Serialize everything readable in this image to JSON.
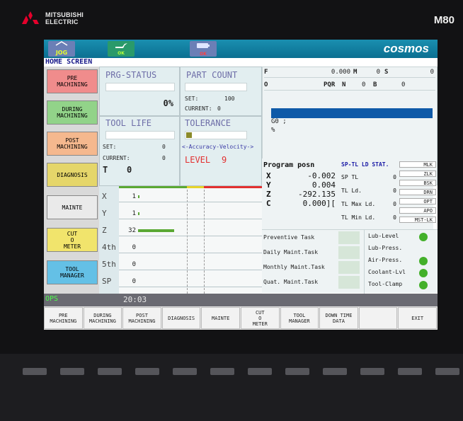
{
  "brand": {
    "logo_line1": "MITSUBISHI",
    "logo_line2": "ELECTRIC",
    "model": "M80"
  },
  "topbar": {
    "mode": "JOG",
    "oil_label": "OK",
    "battery_label": "OK",
    "cosmos": "cosmos"
  },
  "screen_title": "HOME SCREEN",
  "sidebar": [
    {
      "label": "PRE\nMACHINING",
      "color": "#f08c8c"
    },
    {
      "label": "DURING\nMACHINING",
      "color": "#92d389"
    },
    {
      "label": "POST\nMACHINING",
      "color": "#f5b88e"
    },
    {
      "label": "DIAGNOSIS",
      "color": "#e5d66a"
    },
    {
      "label": "MAINTE",
      "color": "#eaeaea"
    },
    {
      "label": "CUT\nO\nMETER",
      "color": "#f1e46c"
    },
    {
      "label": "TOOL\nMANAGER",
      "color": "#64c0e6"
    }
  ],
  "prg_status": {
    "title": "PRG-STATUS",
    "percent": "0%"
  },
  "part_count": {
    "title": "PART COUNT",
    "set_label": "SET:",
    "set_value": "100",
    "current_label": "CURRENT:",
    "current_value": "0"
  },
  "tool_life": {
    "title": "TOOL LIFE",
    "set_label": "SET:",
    "set_value": "0",
    "current_label": "CURRENT:",
    "current_value": "0",
    "t_label": "T",
    "t_value": "0"
  },
  "tolerance": {
    "title": "TOLERANCE",
    "subtitle": "<-Accuracy-Velocity->",
    "level_label": "LEVEL",
    "level_value": "9"
  },
  "load_bars": [
    {
      "axis": "X",
      "value": "1",
      "fraction": 0.01
    },
    {
      "axis": "Y",
      "value": "1",
      "fraction": 0.01
    },
    {
      "axis": "Z",
      "value": "32",
      "fraction": 0.32
    },
    {
      "axis": "4th",
      "value": "0",
      "fraction": 0
    },
    {
      "axis": "5th",
      "value": "0",
      "fraction": 0
    },
    {
      "axis": "SP",
      "value": "0",
      "fraction": 0
    }
  ],
  "feed": {
    "f_label": "F",
    "f_value": "0.000",
    "m_label": "M",
    "m_value": "0",
    "s_label": "S",
    "s_value": "0",
    "o_label": "O",
    "pqr_label": "PQR",
    "n_label": "N",
    "n_value": "0",
    "b_label": "B",
    "b_value": "0",
    "gcode": "G0 ;",
    "percent_sign": "%"
  },
  "program_posn": {
    "title": "Program posn",
    "rows": [
      {
        "axis": "X",
        "value": "-0.002"
      },
      {
        "axis": "Y",
        "value": "0.004"
      },
      {
        "axis": "Z",
        "value": "-292.135"
      },
      {
        "axis": "C",
        "value": "0.000]["
      }
    ]
  },
  "sp_stat": {
    "title": "SP-TL LD STAT.",
    "rows": [
      {
        "label": "SP TL",
        "value": "0"
      },
      {
        "label": "TL Ld.",
        "value": "0"
      },
      {
        "label": "TL Max Ld.",
        "value": "0"
      },
      {
        "label": "TL Min Ld.",
        "value": "0"
      }
    ]
  },
  "modes": [
    "MLK",
    "ZLK",
    "BSK",
    "DRN",
    "OPT",
    "APO",
    "MST-LK"
  ],
  "maintenance": {
    "tasks": [
      "Preventive Task",
      "Daily Maint.Task",
      "Monthly Maint.Task",
      "Quat. Maint.Task"
    ],
    "lub": [
      {
        "label": "Lub-Level",
        "lamp": true
      },
      {
        "label": "Lub-Press.",
        "lamp": false
      },
      {
        "label": "Air-Press.",
        "lamp": true
      },
      {
        "label": "Coolant-Lvl",
        "lamp": true
      },
      {
        "label": "Tool-Clamp",
        "lamp": true
      }
    ]
  },
  "status": {
    "ok": "OPS",
    "clock": "20:03"
  },
  "fkeys": [
    "PRE\nMACHINING",
    "DURING\nMACHINING",
    "POST\nMACHINING",
    "DIAGNOSIS",
    "MAINTE",
    "CUT\nO\nMETER",
    "TOOL\nMANAGER",
    "DOWN TIME\nDATA",
    "",
    "EXIT"
  ],
  "colors": {
    "accent": "#0b6f91",
    "progress_blue": "#0f5aa8",
    "load_green": "#5aa833",
    "lamp_green": "#43b02a",
    "level_red": "#e23030"
  }
}
